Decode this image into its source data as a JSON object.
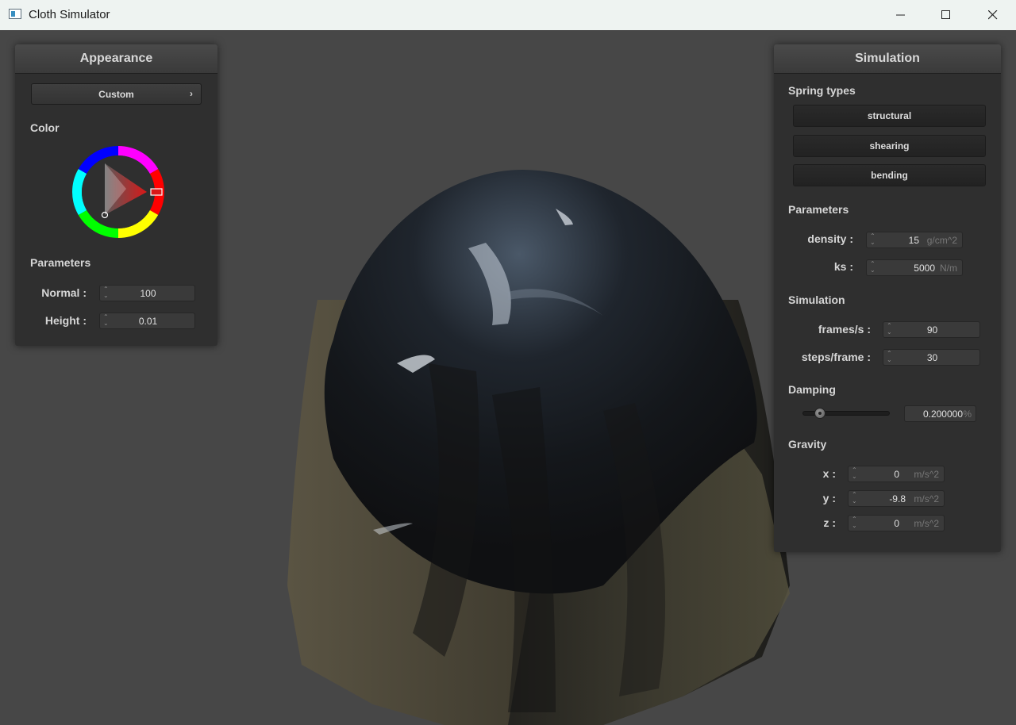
{
  "window": {
    "title": "Cloth Simulator"
  },
  "appearance": {
    "title": "Appearance",
    "preset_label": "Custom",
    "color_label": "Color",
    "color_value": "#d81818",
    "parameters_label": "Parameters",
    "normal_label": "Normal :",
    "normal_value": "100",
    "height_label": "Height :",
    "height_value": "0.01"
  },
  "simulation": {
    "title": "Simulation",
    "spring_types_label": "Spring types",
    "spring_types": [
      "structural",
      "shearing",
      "bending"
    ],
    "parameters_label": "Parameters",
    "density_label": "density :",
    "density_value": "15",
    "density_unit": "g/cm^2",
    "ks_label": "ks :",
    "ks_value": "5000",
    "ks_unit": "N/m",
    "simulation_label": "Simulation",
    "fps_label": "frames/s :",
    "fps_value": "90",
    "steps_label": "steps/frame :",
    "steps_value": "30",
    "damping_label": "Damping",
    "damping_value": "0.200000",
    "damping_unit": "%",
    "damping_fraction": 0.2,
    "gravity_label": "Gravity",
    "gx_label": "x :",
    "gx_value": "0",
    "gy_label": "y :",
    "gy_value": "-9.8",
    "gz_label": "z :",
    "gz_value": "0",
    "gravity_unit": "m/s^2"
  }
}
